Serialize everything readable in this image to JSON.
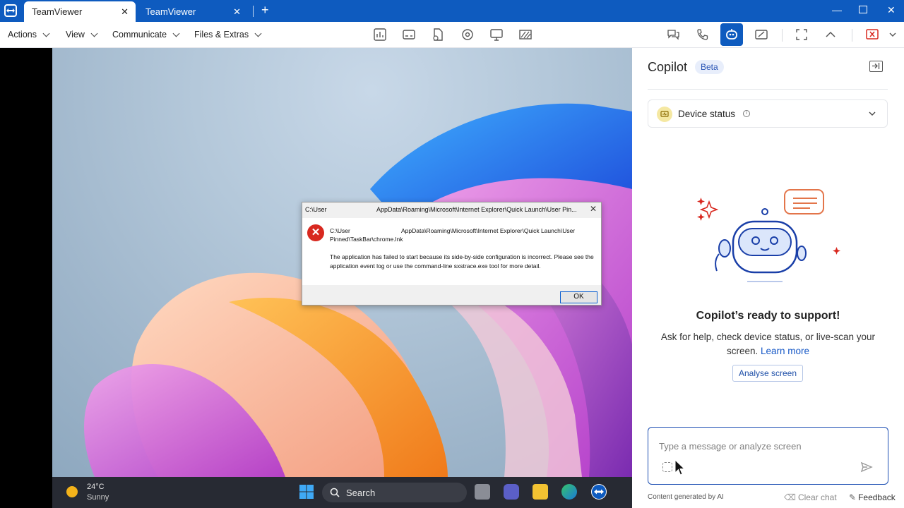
{
  "window": {
    "tabs": [
      {
        "label": "TeamViewer",
        "active": true
      },
      {
        "label": "TeamViewer",
        "active": false
      }
    ]
  },
  "toolbar": {
    "menus": [
      "Actions",
      "View",
      "Communicate",
      "Files & Extras"
    ]
  },
  "remote": {
    "dialog": {
      "title_left": "C:\\User",
      "title_right": "AppData\\Roaming\\Microsoft\\Internet Explorer\\Quick Launch\\User Pin...",
      "path_left": "C:\\User",
      "path_right": "AppData\\Roaming\\Microsoft\\Internet Explorer\\Quick Launch\\User",
      "path_line2": "Pinned\\TaskBar\\chrome.lnk",
      "message": "The application has failed to start because its side-by-side configuration is incorrect. Please see the application event log or use the command-line sxstrace.exe tool for more detail.",
      "ok_label": "OK"
    },
    "taskbar": {
      "temperature": "24°C",
      "weather": "Sunny",
      "search_label": "Search"
    }
  },
  "copilot": {
    "title": "Copilot",
    "badge": "Beta",
    "device_status_label": "Device status",
    "ready_title": "Copilot’s ready to support!",
    "ready_desc": "Ask for help, check device status, or live-scan your screen.",
    "learn_more": "Learn more",
    "analyse_button": "Analyse screen",
    "input_placeholder": "Type a message or analyze screen",
    "footer_note": "Content generated by AI",
    "clear_chat": "Clear chat",
    "feedback": "Feedback"
  },
  "colors": {
    "brand_blue": "#0e5bbf",
    "error_red": "#d8281f"
  }
}
